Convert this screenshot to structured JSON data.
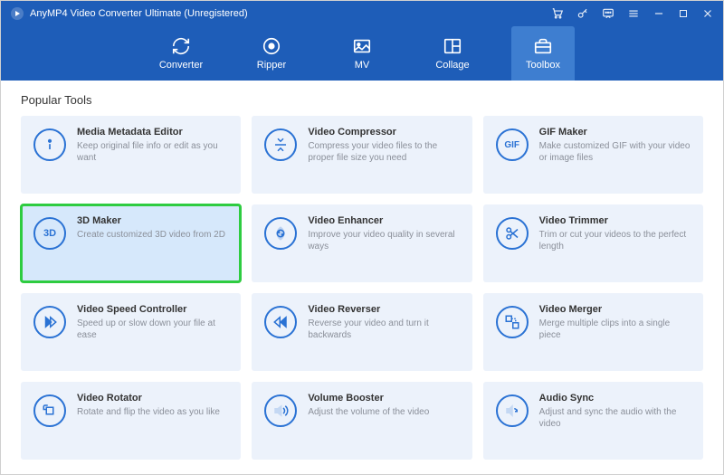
{
  "app": {
    "title": "AnyMP4 Video Converter Ultimate (Unregistered)"
  },
  "nav": {
    "items": [
      {
        "id": "converter",
        "label": "Converter"
      },
      {
        "id": "ripper",
        "label": "Ripper"
      },
      {
        "id": "mv",
        "label": "MV"
      },
      {
        "id": "collage",
        "label": "Collage"
      },
      {
        "id": "toolbox",
        "label": "Toolbox"
      }
    ],
    "active": "toolbox"
  },
  "section": {
    "title": "Popular Tools"
  },
  "tools": [
    {
      "id": "media-metadata-editor",
      "icon": "info",
      "title": "Media Metadata Editor",
      "desc": "Keep original file info or edit as you want",
      "highlight": false
    },
    {
      "id": "video-compressor",
      "icon": "compress",
      "title": "Video Compressor",
      "desc": "Compress your video files to the proper file size you need",
      "highlight": false
    },
    {
      "id": "gif-maker",
      "icon": "gif",
      "title": "GIF Maker",
      "desc": "Make customized GIF with your video or image files",
      "highlight": false
    },
    {
      "id": "3d-maker",
      "icon": "3d",
      "title": "3D Maker",
      "desc": "Create customized 3D video from 2D",
      "highlight": true
    },
    {
      "id": "video-enhancer",
      "icon": "enhance",
      "title": "Video Enhancer",
      "desc": "Improve your video quality in several ways",
      "highlight": false
    },
    {
      "id": "video-trimmer",
      "icon": "trim",
      "title": "Video Trimmer",
      "desc": "Trim or cut your videos to the perfect length",
      "highlight": false
    },
    {
      "id": "video-speed-controller",
      "icon": "speed",
      "title": "Video Speed Controller",
      "desc": "Speed up or slow down your file at ease",
      "highlight": false
    },
    {
      "id": "video-reverser",
      "icon": "reverse",
      "title": "Video Reverser",
      "desc": "Reverse your video and turn it backwards",
      "highlight": false
    },
    {
      "id": "video-merger",
      "icon": "merge",
      "title": "Video Merger",
      "desc": "Merge multiple clips into a single piece",
      "highlight": false
    },
    {
      "id": "video-rotator",
      "icon": "rotate",
      "title": "Video Rotator",
      "desc": "Rotate and flip the video as you like",
      "highlight": false
    },
    {
      "id": "volume-booster",
      "icon": "volume",
      "title": "Volume Booster",
      "desc": "Adjust the volume of the video",
      "highlight": false
    },
    {
      "id": "audio-sync",
      "icon": "sync",
      "title": "Audio Sync",
      "desc": "Adjust and sync the audio with the video",
      "highlight": false
    }
  ]
}
